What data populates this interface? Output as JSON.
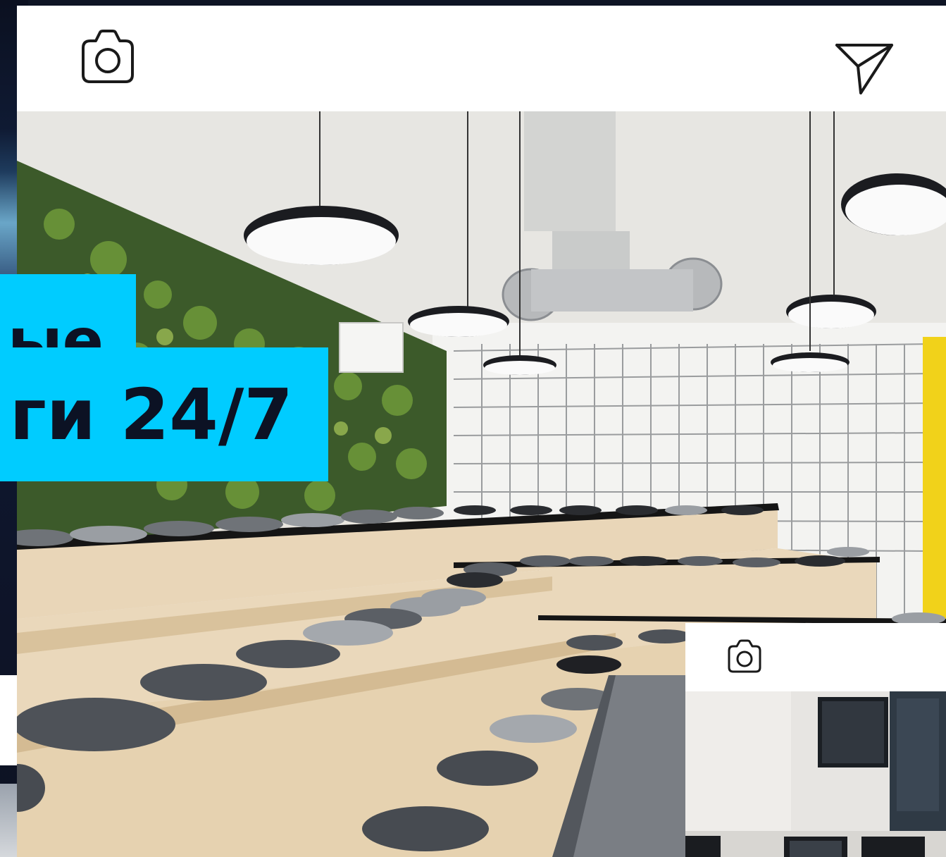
{
  "headline": {
    "line_1": "ые",
    "line_2": "ги 24/7"
  },
  "icons": {
    "camera": "camera-icon",
    "send": "send-icon",
    "camera_small": "camera-icon"
  },
  "colors": {
    "sticker_bg": "#00ccff",
    "sticker_text": "#0c1224",
    "card_bg": "#ffffff",
    "page_bg": "#0e1424"
  }
}
